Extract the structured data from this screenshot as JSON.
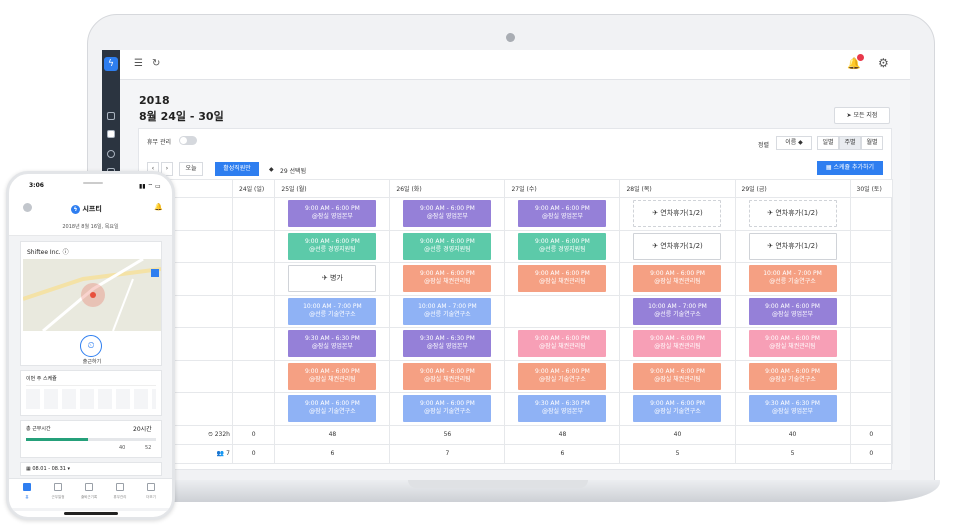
{
  "desktop": {
    "year": "2018",
    "week_range": "8월 24일 - 30일",
    "all_branches": "모든 지점",
    "vacation_mgmt": "휴무 관리",
    "today": "오늘",
    "active_employees": "활성직원만",
    "selected_count": "29 선택됨",
    "sort_label": "정렬",
    "sort_value": "이름",
    "view_day": "일별",
    "view_week": "주별",
    "view_month": "월별",
    "add_schedule": "스케쥴 추가하기",
    "days": [
      "24일 (일)",
      "25일 (월)",
      "26일 (화)",
      "27일 (수)",
      "28일 (목)",
      "29일 (금)",
      "30일 (토)"
    ],
    "rows": [
      [
        null,
        {
          "t": "9:00 AM - 6:00 PM",
          "p": "@잠실 영업본부",
          "c": "#9580d8"
        },
        {
          "t": "9:00 AM - 6:00 PM",
          "p": "@잠실 영업본부",
          "c": "#9580d8"
        },
        {
          "t": "9:00 AM - 6:00 PM",
          "p": "@잠실 영업본부",
          "c": "#9580d8"
        },
        {
          "leave": "연차휴가(1/2)",
          "dash": true
        },
        {
          "leave": "연차휴가(1/2)",
          "dash": true
        },
        null
      ],
      [
        null,
        {
          "t": "9:00 AM - 6:00 PM",
          "p": "@선릉 경영지원팀",
          "c": "#5ccaa9"
        },
        {
          "t": "9:00 AM - 6:00 PM",
          "p": "@선릉 경영지원팀",
          "c": "#5ccaa9"
        },
        {
          "t": "9:00 AM - 6:00 PM",
          "p": "@선릉 경영지원팀",
          "c": "#5ccaa9"
        },
        {
          "leave": "연차휴가(1/2)",
          "dash": false
        },
        {
          "leave": "연차휴가(1/2)",
          "dash": false
        },
        null
      ],
      [
        null,
        {
          "leave": "병가",
          "dash": false
        },
        {
          "t": "9:00 AM - 6:00 PM",
          "p": "@잠실 채권관리팀",
          "c": "#f5a083"
        },
        {
          "t": "9:00 AM - 6:00 PM",
          "p": "@잠실 채권관리팀",
          "c": "#f5a083"
        },
        {
          "t": "9:00 AM - 6:00 PM",
          "p": "@잠실 채권관리팀",
          "c": "#f5a083"
        },
        {
          "t": "10:00 AM - 7:00 PM",
          "p": "@선릉 기술연구소",
          "c": "#f5a083"
        },
        null
      ],
      [
        null,
        {
          "t": "10:00 AM - 7:00 PM",
          "p": "@선릉 기술연구소",
          "c": "#8fb2f5"
        },
        {
          "t": "10:00 AM - 7:00 PM",
          "p": "@선릉 기술연구소",
          "c": "#8fb2f5"
        },
        null,
        {
          "t": "10:00 AM - 7:00 PM",
          "p": "@선릉 기술연구소",
          "c": "#9580d8"
        },
        {
          "t": "9:00 AM - 6:00 PM",
          "p": "@잠실 영업본부",
          "c": "#9580d8"
        },
        null
      ],
      [
        null,
        {
          "t": "9:30 AM - 6:30 PM",
          "p": "@잠실 영업본부",
          "c": "#9580d8"
        },
        {
          "t": "9:30 AM - 6:30 PM",
          "p": "@잠실 영업본부",
          "c": "#9580d8"
        },
        {
          "t": "9:00 AM - 6:00 PM",
          "p": "@잠실 채권관리팀",
          "c": "#f79fb6"
        },
        {
          "t": "9:00 AM - 6:00 PM",
          "p": "@잠실 채권관리팀",
          "c": "#f79fb6"
        },
        {
          "t": "9:00 AM - 6:00 PM",
          "p": "@잠실 채권관리팀",
          "c": "#f79fb6"
        },
        null
      ],
      [
        null,
        {
          "t": "9:00 AM - 6:00 PM",
          "p": "@잠실 채권관리팀",
          "c": "#f5a083"
        },
        {
          "t": "9:00 AM - 6:00 PM",
          "p": "@잠실 채권관리팀",
          "c": "#f5a083"
        },
        {
          "t": "9:00 AM - 6:00 PM",
          "p": "@잠실 기술연구소",
          "c": "#f5a083"
        },
        {
          "t": "9:00 AM - 6:00 PM",
          "p": "@잠실 채권관리팀",
          "c": "#f5a083"
        },
        {
          "t": "9:00 AM - 6:00 PM",
          "p": "@잠실 기술연구소",
          "c": "#f5a083"
        },
        null
      ],
      [
        null,
        {
          "t": "9:00 AM - 6:00 PM",
          "p": "@잠실 기술연구소",
          "c": "#8fb2f5"
        },
        {
          "t": "9:00 AM - 6:00 PM",
          "p": "@잠실 기술연구소",
          "c": "#8fb2f5"
        },
        {
          "t": "9:30 AM - 6:30 PM",
          "p": "@잠실 영업본부",
          "c": "#8fb2f5"
        },
        {
          "t": "9:00 AM - 6:00 PM",
          "p": "@잠실 기술연구소",
          "c": "#8fb2f5"
        },
        {
          "t": "9:30 AM - 6:30 PM",
          "p": "@잠실 영업본부",
          "c": "#8fb2f5"
        },
        null
      ]
    ],
    "total_hours_label": "232h",
    "total_hours": [
      "0",
      "48",
      "56",
      "48",
      "40",
      "40",
      "0"
    ],
    "total_people_label": "7",
    "total_people": [
      "0",
      "6",
      "7",
      "6",
      "5",
      "5",
      "0"
    ]
  },
  "phone": {
    "time": "3:06",
    "app_name": "시프티",
    "date": "2018년 8월 16일, 목요일",
    "company": "Shiftee Inc.",
    "clock_in": "출근하기",
    "week_title": "이번 주 스케쥴",
    "work_hours_label": "총 근무시간",
    "work_hours_value": "20시간",
    "hours_a": "40",
    "hours_b": "52",
    "period": "08.01 - 08.31",
    "tabs": [
      "홈",
      "근무일정",
      "출퇴근기록",
      "휴무관리",
      "더보기"
    ]
  }
}
